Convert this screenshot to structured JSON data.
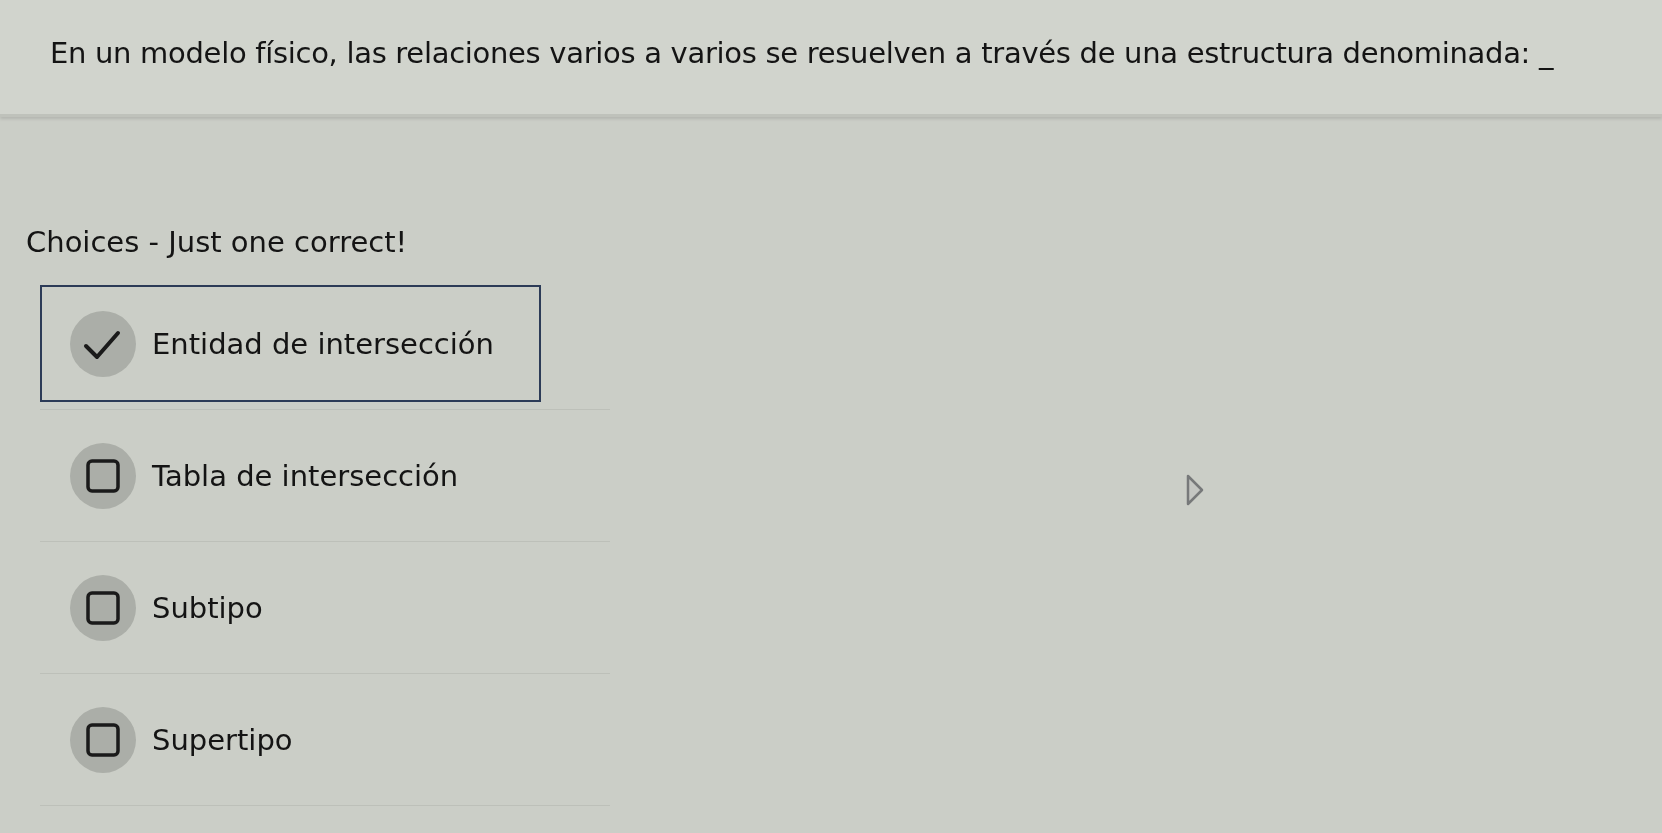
{
  "question": {
    "text": "En un modelo físico, las relaciones varios a varios se resuelven a través de una estructura denominada: _"
  },
  "choices": {
    "heading": "Choices - Just one correct!",
    "options": [
      {
        "label": "Entidad de intersección",
        "selected": true
      },
      {
        "label": "Tabla de intersección",
        "selected": false
      },
      {
        "label": "Subtipo",
        "selected": false
      },
      {
        "label": "Supertipo",
        "selected": false
      }
    ]
  }
}
